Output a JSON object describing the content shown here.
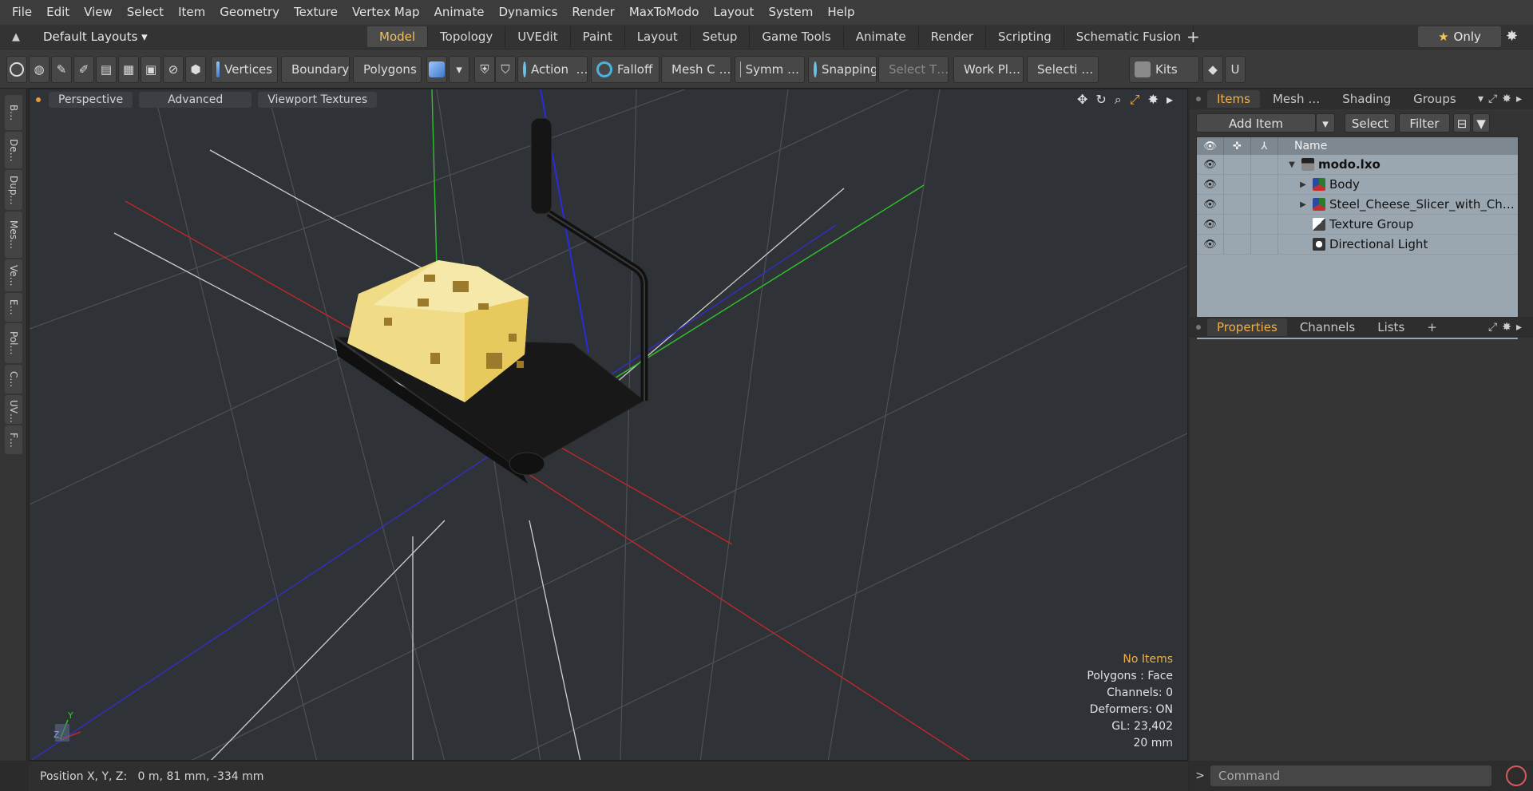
{
  "menu": [
    "File",
    "Edit",
    "View",
    "Select",
    "Item",
    "Geometry",
    "Texture",
    "Vertex Map",
    "Animate",
    "Dynamics",
    "Render",
    "MaxToModo",
    "Layout",
    "System",
    "Help"
  ],
  "layoutbar": {
    "default_layouts": "Default Layouts ▾",
    "tabs": [
      "Model",
      "Topology",
      "UVEdit",
      "Paint",
      "Layout",
      "Setup",
      "Game Tools",
      "Animate",
      "Render",
      "Scripting",
      "Schematic Fusion"
    ],
    "active_tab": "Model",
    "plus": "+",
    "only": "Only"
  },
  "toolbar": {
    "vertices": "Vertices",
    "boundary": "Boundary",
    "polygons": "Polygons",
    "action": "Action",
    "action_more": "…",
    "falloff": "Falloff",
    "mesh_c": "Mesh C …",
    "symm": "Symm …",
    "snapping": "Snapping",
    "select_t": "Select T…",
    "work_pl": "Work Pl…",
    "selecti": "Selecti …",
    "kits": "Kits"
  },
  "left_tabs": [
    "B…",
    "De…",
    "Dup…",
    "Mes…",
    "Ve…",
    "E…",
    "Pol…",
    "C…",
    "UV…",
    "F…"
  ],
  "viewport": {
    "tabs": [
      "Perspective",
      "Advanced",
      "Viewport Textures"
    ],
    "info": {
      "selection": "No Items",
      "polygons": "Polygons : Face",
      "channels": "Channels: 0",
      "deformers": "Deformers: ON",
      "gl": "GL: 23,402",
      "grid": "20 mm"
    },
    "axis_y": "Y",
    "axis_z": "Z"
  },
  "status": {
    "position": "Position X, Y, Z:   0 m, 81 mm, -334 mm"
  },
  "items_panel": {
    "tabs": [
      "Items",
      "Mesh …",
      "Shading",
      "Groups"
    ],
    "add_item": "Add Item",
    "select": "Select",
    "filter": "Filter",
    "name_header": "Name",
    "rows": [
      {
        "label": "modo.lxo",
        "indent": 0,
        "expander": "▼",
        "icon": "scene"
      },
      {
        "label": "Body",
        "indent": 1,
        "expander": "▶",
        "icon": "loc"
      },
      {
        "label": "Steel_Cheese_Slicer_with_Ch…",
        "indent": 1,
        "expander": "▶",
        "icon": "loc"
      },
      {
        "label": "Texture Group",
        "indent": 1,
        "expander": "",
        "icon": "tex"
      },
      {
        "label": "Directional Light",
        "indent": 1,
        "expander": "",
        "icon": "light"
      }
    ]
  },
  "props_panel": {
    "tabs": [
      "Properties",
      "Channels",
      "Lists"
    ],
    "plus": "+"
  },
  "command": {
    "placeholder": "Command"
  },
  "colors": {
    "accent": "#f0b04a",
    "x_axis": "#d03030",
    "y_axis": "#30d030",
    "z_axis": "#3a3ad8",
    "cheese": "#f2df8a",
    "tray": "#1c1c1c"
  }
}
